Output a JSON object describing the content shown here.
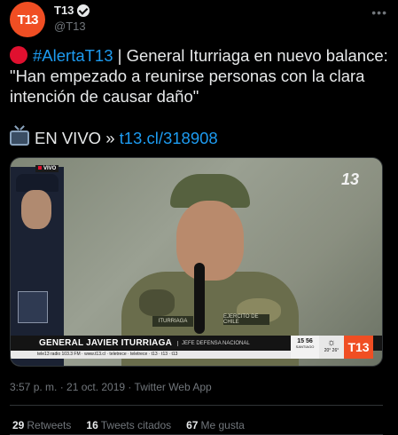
{
  "account": {
    "avatar_text": "T13",
    "display_name": "T13",
    "handle": "@T13",
    "verified": true,
    "brand_color": "#f04e23"
  },
  "menu": {
    "more_label": "•••"
  },
  "tweet": {
    "hashtag": "#AlertaT13",
    "text": " | General Iturriaga en nuevo balance: \"Han empezado a reunirse personas con la clara intención de causar daño\"",
    "live_prefix": "EN VIVO »",
    "link": "t13.cl/318908",
    "accent_color": "#1d9bf0"
  },
  "video": {
    "live_tag": "VIVO",
    "watermark": "13",
    "lower_third_name": "GENERAL JAVIER ITURRIAGA",
    "lower_third_role": "JEFE DEFENSA NACIONAL",
    "ticker": "tele13 radio 103.3 FM  ·  www.t13.cl  ·  teletrece  ·  teletrece  ·  t13  ·  t13  ·  t13",
    "clock_time": "15 56",
    "clock_city": "SANTIAGO",
    "weather_temps": "20° 26°",
    "weather_icon": "sun-icon",
    "logo_text": "T13",
    "name_tag_left": "ITURRIAGA",
    "name_tag_right": "EJERCITO DE CHILE"
  },
  "meta": {
    "timestamp": "3:57 p. m. · 21 oct. 2019 · Twitter Web App"
  },
  "stats": {
    "retweets_count": "29",
    "retweets_label": "Retweets",
    "quotes_count": "16",
    "quotes_label": "Tweets citados",
    "likes_count": "67",
    "likes_label": "Me gusta"
  }
}
